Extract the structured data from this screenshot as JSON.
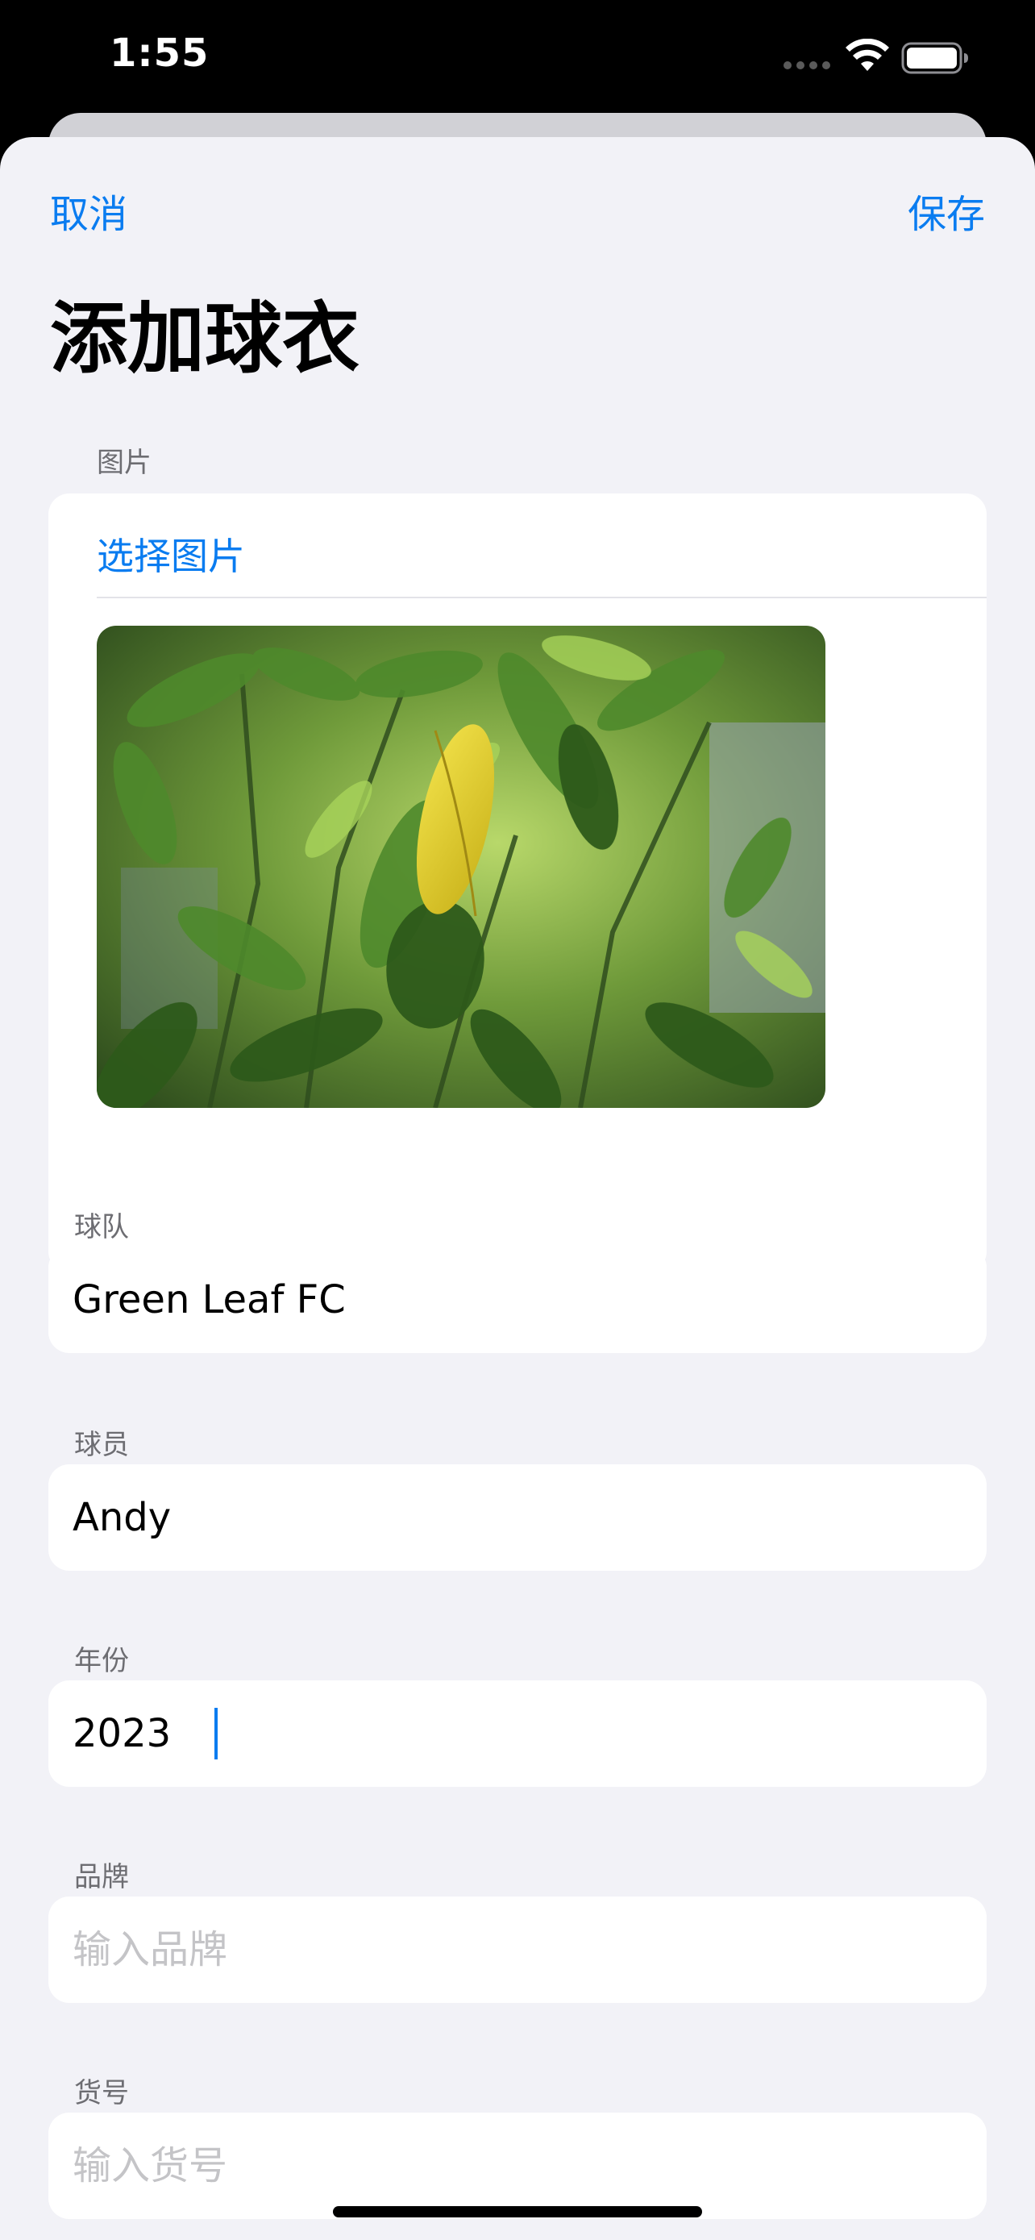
{
  "status_bar": {
    "time": "1:55",
    "icons": [
      "signal-dots-icon",
      "wifi-icon",
      "battery-icon"
    ]
  },
  "nav": {
    "cancel_label": "取消",
    "save_label": "保存"
  },
  "title": "添加球衣",
  "photo_section": {
    "label": "图片",
    "choose_label": "选择图片",
    "image_description": "leafy-plant-photo"
  },
  "fields": [
    {
      "label": "球队",
      "value": "Green Leaf FC",
      "placeholder": ""
    },
    {
      "label": "球员",
      "value": "Andy",
      "placeholder": ""
    },
    {
      "label": "年份",
      "value": "2023",
      "placeholder": ""
    },
    {
      "label": "品牌",
      "value": "",
      "placeholder": "输入品牌"
    },
    {
      "label": "货号",
      "value": "",
      "placeholder": "输入货号"
    }
  ],
  "colors": {
    "accent": "#0a7cf0",
    "sheet_background": "#f2f2f7",
    "card_background": "#ffffff",
    "label_gray": "#6d6d72",
    "placeholder_gray": "#c4c4c7"
  }
}
